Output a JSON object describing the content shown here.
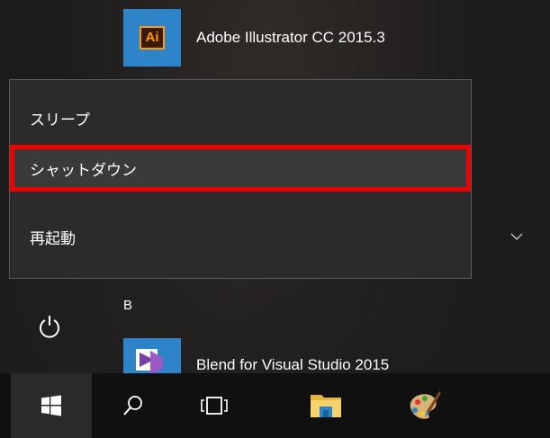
{
  "start_menu": {
    "apps": [
      {
        "name": "Adobe Illustrator CC 2015.3",
        "icon": "adobe-illustrator-icon",
        "tile_text": "Ai"
      },
      {
        "name": "Blend for Visual Studio 2015",
        "icon": "blend-visual-studio-icon"
      }
    ],
    "section_letter": "B",
    "power_icon": "power-icon",
    "expand_icon": "chevron-down-icon"
  },
  "power_menu": {
    "items": [
      {
        "label": "スリープ"
      },
      {
        "label": "シャットダウン",
        "highlighted": true
      },
      {
        "label": "再起動"
      }
    ],
    "highlight_color": "#ee0000"
  },
  "taskbar": {
    "buttons": [
      {
        "icon": "windows-start-icon"
      },
      {
        "icon": "search-icon"
      },
      {
        "icon": "task-view-icon"
      },
      {
        "icon": "file-explorer-icon"
      },
      {
        "icon": "paint-icon"
      }
    ]
  },
  "colors": {
    "tile_blue": "#2d84c9",
    "menu_bg": "#2b2b2b",
    "taskbar_bg": "#101010"
  }
}
